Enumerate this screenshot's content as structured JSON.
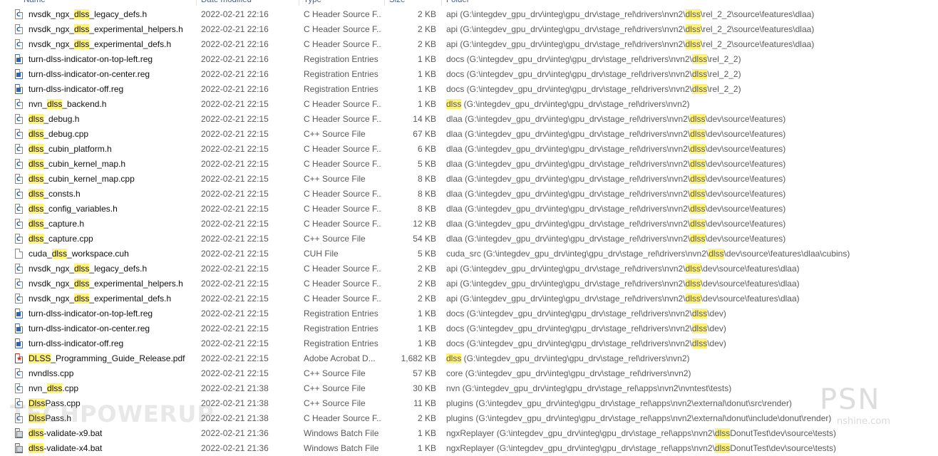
{
  "header": {
    "name": "Name",
    "date_modified": "Date modified",
    "type": "Type",
    "size": "Size",
    "folder": "Folder"
  },
  "highlight_color": "#fff27a",
  "files": [
    {
      "icon": "c-file-icon",
      "name": [
        "nvsdk_ngx_",
        "dlss",
        "_legacy_defs.h"
      ],
      "date": "2022-02-21 22:16",
      "type": "C Header Source F...",
      "size": "2 KB",
      "folder": [
        "api (G:\\integdev_gpu_drv\\integ\\gpu_drv\\stage_rel\\drivers\\nvn2\\",
        "dlss",
        "\\rel_2_2\\source\\features\\dlaa)"
      ]
    },
    {
      "icon": "c-file-icon",
      "name": [
        "nvsdk_ngx_",
        "dlss",
        "_experimental_helpers.h"
      ],
      "date": "2022-02-21 22:16",
      "type": "C Header Source F...",
      "size": "2 KB",
      "folder": [
        "api (G:\\integdev_gpu_drv\\integ\\gpu_drv\\stage_rel\\drivers\\nvn2\\",
        "dlss",
        "\\rel_2_2\\source\\features\\dlaa)"
      ]
    },
    {
      "icon": "c-file-icon",
      "name": [
        "nvsdk_ngx_",
        "dlss",
        "_experimental_defs.h"
      ],
      "date": "2022-02-21 22:16",
      "type": "C Header Source F...",
      "size": "2 KB",
      "folder": [
        "api (G:\\integdev_gpu_drv\\integ\\gpu_drv\\stage_rel\\drivers\\nvn2\\",
        "dlss",
        "\\rel_2_2\\source\\features\\dlaa)"
      ]
    },
    {
      "icon": "reg-file-icon",
      "name": [
        "turn-dlss-indicator-on-top-left.reg"
      ],
      "date": "2022-02-21 22:16",
      "type": "Registration Entries",
      "size": "1 KB",
      "folder": [
        "docs (G:\\integdev_gpu_drv\\integ\\gpu_drv\\stage_rel\\drivers\\nvn2\\",
        "dlss",
        "\\rel_2_2)"
      ]
    },
    {
      "icon": "reg-file-icon",
      "name": [
        "turn-dlss-indicator-on-center.reg"
      ],
      "date": "2022-02-21 22:16",
      "type": "Registration Entries",
      "size": "1 KB",
      "folder": [
        "docs (G:\\integdev_gpu_drv\\integ\\gpu_drv\\stage_rel\\drivers\\nvn2\\",
        "dlss",
        "\\rel_2_2)"
      ]
    },
    {
      "icon": "reg-file-icon",
      "name": [
        "turn-dlss-indicator-off.reg"
      ],
      "date": "2022-02-21 22:16",
      "type": "Registration Entries",
      "size": "1 KB",
      "folder": [
        "docs (G:\\integdev_gpu_drv\\integ\\gpu_drv\\stage_rel\\drivers\\nvn2\\",
        "dlss",
        "\\rel_2_2)"
      ]
    },
    {
      "icon": "c-file-icon",
      "name": [
        "nvn_",
        "dlss",
        "_backend.h"
      ],
      "date": "2022-02-21 22:15",
      "type": "C Header Source F...",
      "size": "1 KB",
      "folder": [
        "",
        "dlss",
        " (G:\\integdev_gpu_drv\\integ\\gpu_drv\\stage_rel\\drivers\\nvn2)"
      ]
    },
    {
      "icon": "c-file-icon",
      "name": [
        "",
        "dlss",
        "_debug.h"
      ],
      "date": "2022-02-21 22:15",
      "type": "C Header Source F...",
      "size": "14 KB",
      "folder": [
        "dlaa (G:\\integdev_gpu_drv\\integ\\gpu_drv\\stage_rel\\drivers\\nvn2\\",
        "dlss",
        "\\dev\\source\\features)"
      ]
    },
    {
      "icon": "cpp-file-icon",
      "name": [
        "",
        "dlss",
        "_debug.cpp"
      ],
      "date": "2022-02-21 22:15",
      "type": "C++ Source File",
      "size": "67 KB",
      "folder": [
        "dlaa (G:\\integdev_gpu_drv\\integ\\gpu_drv\\stage_rel\\drivers\\nvn2\\",
        "dlss",
        "\\dev\\source\\features)"
      ]
    },
    {
      "icon": "c-file-icon",
      "name": [
        "",
        "dlss",
        "_cubin_platform.h"
      ],
      "date": "2022-02-21 22:15",
      "type": "C Header Source F...",
      "size": "6 KB",
      "folder": [
        "dlaa (G:\\integdev_gpu_drv\\integ\\gpu_drv\\stage_rel\\drivers\\nvn2\\",
        "dlss",
        "\\dev\\source\\features)"
      ]
    },
    {
      "icon": "c-file-icon",
      "name": [
        "",
        "dlss",
        "_cubin_kernel_map.h"
      ],
      "date": "2022-02-21 22:15",
      "type": "C Header Source F...",
      "size": "5 KB",
      "folder": [
        "dlaa (G:\\integdev_gpu_drv\\integ\\gpu_drv\\stage_rel\\drivers\\nvn2\\",
        "dlss",
        "\\dev\\source\\features)"
      ]
    },
    {
      "icon": "cpp-file-icon",
      "name": [
        "",
        "dlss",
        "_cubin_kernel_map.cpp"
      ],
      "date": "2022-02-21 22:15",
      "type": "C++ Source File",
      "size": "8 KB",
      "folder": [
        "dlaa (G:\\integdev_gpu_drv\\integ\\gpu_drv\\stage_rel\\drivers\\nvn2\\",
        "dlss",
        "\\dev\\source\\features)"
      ]
    },
    {
      "icon": "c-file-icon",
      "name": [
        "",
        "dlss",
        "_consts.h"
      ],
      "date": "2022-02-21 22:15",
      "type": "C Header Source F...",
      "size": "8 KB",
      "folder": [
        "dlaa (G:\\integdev_gpu_drv\\integ\\gpu_drv\\stage_rel\\drivers\\nvn2\\",
        "dlss",
        "\\dev\\source\\features)"
      ]
    },
    {
      "icon": "c-file-icon",
      "name": [
        "",
        "dlss",
        "_config_variables.h"
      ],
      "date": "2022-02-21 22:15",
      "type": "C Header Source F...",
      "size": "8 KB",
      "folder": [
        "dlaa (G:\\integdev_gpu_drv\\integ\\gpu_drv\\stage_rel\\drivers\\nvn2\\",
        "dlss",
        "\\dev\\source\\features)"
      ]
    },
    {
      "icon": "c-file-icon",
      "name": [
        "",
        "dlss",
        "_capture.h"
      ],
      "date": "2022-02-21 22:15",
      "type": "C Header Source F...",
      "size": "12 KB",
      "folder": [
        "dlaa (G:\\integdev_gpu_drv\\integ\\gpu_drv\\stage_rel\\drivers\\nvn2\\",
        "dlss",
        "\\dev\\source\\features)"
      ]
    },
    {
      "icon": "cpp-file-icon",
      "name": [
        "",
        "dlss",
        "_capture.cpp"
      ],
      "date": "2022-02-21 22:15",
      "type": "C++ Source File",
      "size": "54 KB",
      "folder": [
        "dlaa (G:\\integdev_gpu_drv\\integ\\gpu_drv\\stage_rel\\drivers\\nvn2\\",
        "dlss",
        "\\dev\\source\\features)"
      ]
    },
    {
      "icon": "cuh-file-icon",
      "name": [
        "cuda_",
        "dlss",
        "_workspace.cuh"
      ],
      "date": "2022-02-21 22:15",
      "type": "CUH File",
      "size": "5 KB",
      "folder": [
        "cuda_src (G:\\integdev_gpu_drv\\integ\\gpu_drv\\stage_rel\\drivers\\nvn2\\",
        "dlss",
        "\\dev\\source\\features\\dlaa\\cubins)"
      ]
    },
    {
      "icon": "c-file-icon",
      "name": [
        "nvsdk_ngx_",
        "dlss",
        "_legacy_defs.h"
      ],
      "date": "2022-02-21 22:15",
      "type": "C Header Source F...",
      "size": "2 KB",
      "folder": [
        "api (G:\\integdev_gpu_drv\\integ\\gpu_drv\\stage_rel\\drivers\\nvn2\\",
        "dlss",
        "\\dev\\source\\features\\dlaa)"
      ]
    },
    {
      "icon": "c-file-icon",
      "name": [
        "nvsdk_ngx_",
        "dlss",
        "_experimental_helpers.h"
      ],
      "date": "2022-02-21 22:15",
      "type": "C Header Source F...",
      "size": "2 KB",
      "folder": [
        "api (G:\\integdev_gpu_drv\\integ\\gpu_drv\\stage_rel\\drivers\\nvn2\\",
        "dlss",
        "\\dev\\source\\features\\dlaa)"
      ]
    },
    {
      "icon": "c-file-icon",
      "name": [
        "nvsdk_ngx_",
        "dlss",
        "_experimental_defs.h"
      ],
      "date": "2022-02-21 22:15",
      "type": "C Header Source F...",
      "size": "2 KB",
      "folder": [
        "api (G:\\integdev_gpu_drv\\integ\\gpu_drv\\stage_rel\\drivers\\nvn2\\",
        "dlss",
        "\\dev\\source\\features\\dlaa)"
      ]
    },
    {
      "icon": "reg-file-icon",
      "name": [
        "turn-dlss-indicator-on-top-left.reg"
      ],
      "date": "2022-02-21 22:15",
      "type": "Registration Entries",
      "size": "1 KB",
      "folder": [
        "docs (G:\\integdev_gpu_drv\\integ\\gpu_drv\\stage_rel\\drivers\\nvn2\\",
        "dlss",
        "\\dev)"
      ]
    },
    {
      "icon": "reg-file-icon",
      "name": [
        "turn-dlss-indicator-on-center.reg"
      ],
      "date": "2022-02-21 22:15",
      "type": "Registration Entries",
      "size": "1 KB",
      "folder": [
        "docs (G:\\integdev_gpu_drv\\integ\\gpu_drv\\stage_rel\\drivers\\nvn2\\",
        "dlss",
        "\\dev)"
      ]
    },
    {
      "icon": "reg-file-icon",
      "name": [
        "turn-dlss-indicator-off.reg"
      ],
      "date": "2022-02-21 22:15",
      "type": "Registration Entries",
      "size": "1 KB",
      "folder": [
        "docs (G:\\integdev_gpu_drv\\integ\\gpu_drv\\stage_rel\\drivers\\nvn2\\",
        "dlss",
        "\\dev)"
      ]
    },
    {
      "icon": "pdf-file-icon",
      "name": [
        "",
        "DLSS",
        "_Programming_Guide_Release.pdf"
      ],
      "date": "2022-02-21 22:15",
      "type": "Adobe Acrobat D...",
      "size": "1,682 KB",
      "folder": [
        "",
        "dlss",
        " (G:\\integdev_gpu_drv\\integ\\gpu_drv\\stage_rel\\drivers\\nvn2)"
      ]
    },
    {
      "icon": "cpp-file-icon",
      "name": [
        "nvndlss.cpp"
      ],
      "date": "2022-02-21 22:15",
      "type": "C++ Source File",
      "size": "57 KB",
      "folder": [
        "core (G:\\integdev_gpu_drv\\integ\\gpu_drv\\stage_rel\\drivers\\nvn2)"
      ]
    },
    {
      "icon": "cpp-file-icon",
      "name": [
        "nvn_",
        "dlss",
        ".cpp"
      ],
      "date": "2022-02-21 21:38",
      "type": "C++ Source File",
      "size": "30 KB",
      "folder": [
        "nvn (G:\\integdev_gpu_drv\\integ\\gpu_drv\\stage_rel\\apps\\nvn2\\nvntest\\tests)"
      ]
    },
    {
      "icon": "cpp-file-icon",
      "name": [
        "",
        "Dlss",
        "Pass.cpp"
      ],
      "date": "2022-02-21 21:38",
      "type": "C++ Source File",
      "size": "11 KB",
      "folder": [
        "plugins (G:\\integdev_gpu_drv\\integ\\gpu_drv\\stage_rel\\apps\\nvn2\\external\\donut\\src\\render)"
      ]
    },
    {
      "icon": "c-file-icon",
      "name": [
        "",
        "Dlss",
        "Pass.h"
      ],
      "date": "2022-02-21 21:38",
      "type": "C Header Source F...",
      "size": "2 KB",
      "folder": [
        "plugins (G:\\integdev_gpu_drv\\integ\\gpu_drv\\stage_rel\\apps\\nvn2\\external\\donut\\include\\donut\\render)"
      ]
    },
    {
      "icon": "bat-file-icon",
      "name": [
        "",
        "dlss",
        "-validate-x9.bat"
      ],
      "date": "2022-02-21 21:36",
      "type": "Windows Batch File",
      "size": "1 KB",
      "folder": [
        "ngxReplayer (G:\\integdev_gpu_drv\\integ\\gpu_drv\\stage_rel\\apps\\nvn2\\",
        "dlss",
        "DonutTest\\dev\\source\\tests)"
      ]
    },
    {
      "icon": "bat-file-icon",
      "name": [
        "",
        "dlss",
        "-validate-x4.bat"
      ],
      "date": "2022-02-21 21:36",
      "type": "Windows Batch File",
      "size": "1 KB",
      "folder": [
        "ngxReplayer (G:\\integdev_gpu_drv\\integ\\gpu_drv\\stage_rel\\apps\\nvn2\\",
        "dlss",
        "DonutTest\\dev\\source\\tests)"
      ]
    }
  ],
  "watermarks": {
    "left": "TECHPOWERUP",
    "right": "PSN",
    "right_sub": "nshine.com"
  }
}
